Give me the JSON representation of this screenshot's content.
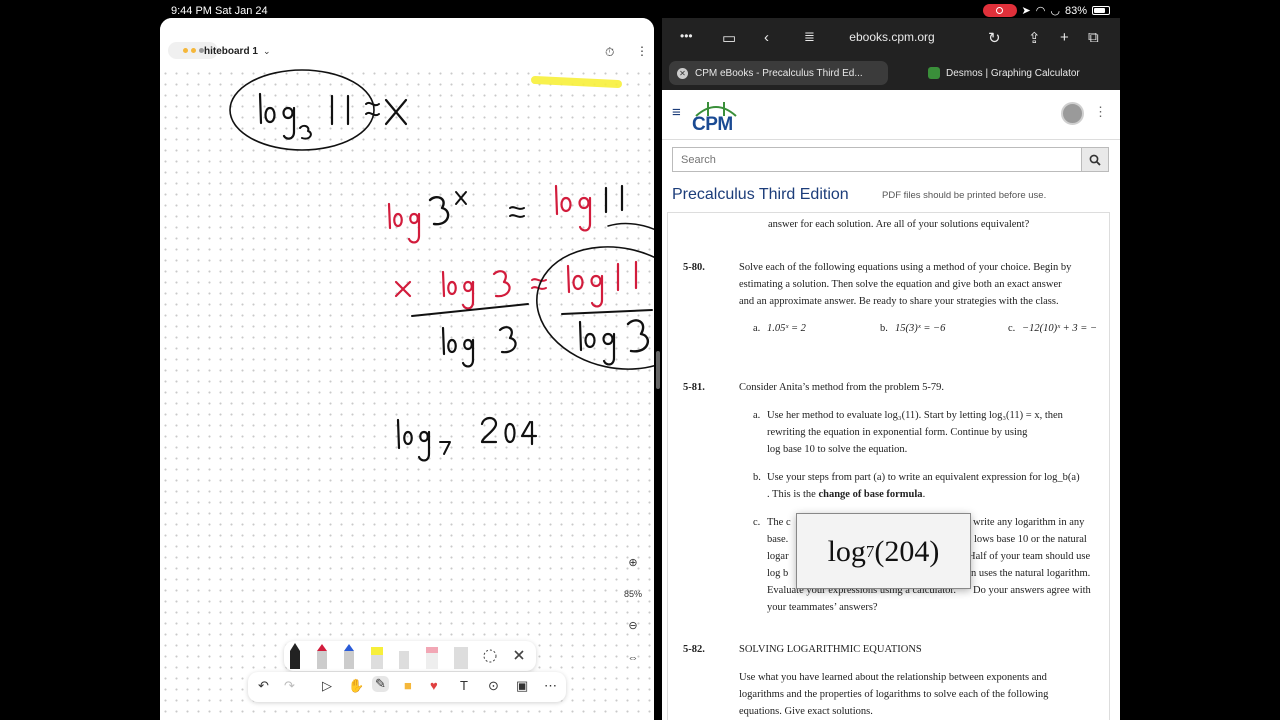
{
  "status": {
    "time": "9:44 PM  Sat Jan 24",
    "battery": "83%"
  },
  "freeform": {
    "title": "hiteboard 1",
    "zoom": "85%",
    "ink": {
      "top_eq": "log₃11 = x",
      "line2": "log 3ˣ = log 11",
      "line3": "x log 3 = log 11 / log 3",
      "line4": "log₇ 204"
    }
  },
  "safari": {
    "url": "ebooks.cpm.org",
    "tabs": [
      {
        "label": "CPM eBooks - Precalculus Third Ed...",
        "active": true
      },
      {
        "label": "Desmos | Graphing Calculator",
        "active": false
      }
    ]
  },
  "cpm": {
    "logo": "CPM",
    "search_placeholder": "Search",
    "book_title": "Precalculus Third Edition",
    "pdf_note": "PDF files should be printed before use.",
    "prev_tail": "answer for each solution. Are all of your solutions equivalent?",
    "p580": {
      "num": "5-80.",
      "lines": [
        "Solve each of the following equations using a method of your choice. Begin by",
        "estimating a solution. Then solve the equation and give both an exact answer",
        "and an approximate answer. Be ready to share your strategies with the class."
      ],
      "parts": [
        {
          "label": "a.",
          "expr": "1.05ˣ = 2"
        },
        {
          "label": "b.",
          "expr": "15(3)ˣ = −6"
        },
        {
          "label": "c.",
          "expr": "−12(10)ˣ + 3 = −"
        }
      ]
    },
    "p581": {
      "num": "5-81.",
      "intro": "Consider Anita’s method from the problem 5-79.",
      "a_label": "a.",
      "a_lines": [
        "Use her method to evaluate log₃(11). Start by letting log₃(11) = x, then",
        "rewriting the equation in exponential form. Continue by using",
        "log base 10 to solve the equation."
      ],
      "b_label": "b.",
      "b_line1": "Use your steps from part (a) to write an equivalent expression for log_b(a)",
      "b_line2a": ". This is the ",
      "b_line2b": "change of base formula",
      "b_line2c": ".",
      "c_label": "c.",
      "c_lines": [
        {
          "left": "The c",
          "right": "write any logarithm in any"
        },
        {
          "left": "base.",
          "right": "lows base 10 or the natural"
        },
        {
          "left": "logar",
          "right": "Half of your team should use"
        },
        {
          "left": "log b",
          "right": "n uses the natural logarithm."
        },
        {
          "left": "Evaluate your expressions using a calculator.",
          "right": "Do your answers agree with"
        },
        {
          "left": "your teammates’ answers?",
          "right": ""
        }
      ]
    },
    "p582": {
      "num": "5-82.",
      "heading": "SOLVING LOGARITHMIC EQUATIONS",
      "lines": [
        "Use what you have learned about the relationship between exponents and",
        "logarithms and the properties of logarithms to solve each of the following",
        "equations. Give exact solutions."
      ]
    },
    "popup": {
      "base": "log",
      "sub": "7",
      "arg": "(204)"
    }
  },
  "colors": {
    "ink_black": "#111111",
    "ink_red": "#d21c3c",
    "cpm_blue": "#1a4a93",
    "highlight": "#f7ef3a"
  }
}
